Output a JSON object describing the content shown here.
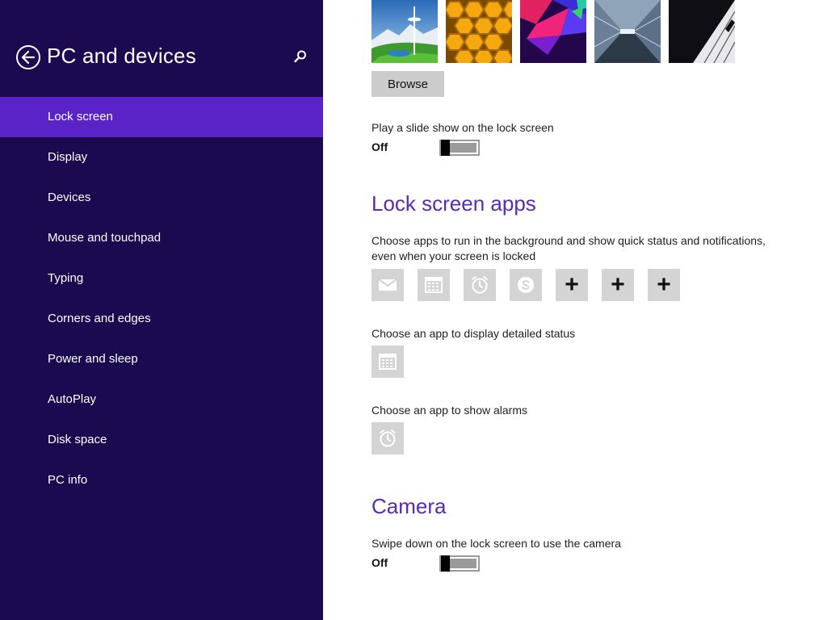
{
  "sidebar": {
    "title": "PC and devices",
    "items": [
      {
        "label": "Lock screen",
        "active": true
      },
      {
        "label": "Display"
      },
      {
        "label": "Devices"
      },
      {
        "label": "Mouse and touchpad"
      },
      {
        "label": "Typing"
      },
      {
        "label": "Corners and edges"
      },
      {
        "label": "Power and sleep"
      },
      {
        "label": "AutoPlay"
      },
      {
        "label": "Disk space"
      },
      {
        "label": "PC info"
      }
    ]
  },
  "main": {
    "browse_label": "Browse",
    "slideshow": {
      "label": "Play a slide show on the lock screen",
      "state": "Off"
    },
    "lock_apps": {
      "heading": "Lock screen apps",
      "desc": "Choose apps to run in the background and show quick status and notifications, even when your screen is locked",
      "apps": [
        "mail-icon",
        "calendar-icon",
        "alarm-icon",
        "skype-icon",
        "plus-icon",
        "plus-icon",
        "plus-icon"
      ],
      "plus_symbol": "+"
    },
    "detailed_status": {
      "label": "Choose an app to display detailed status",
      "app": "calendar-icon"
    },
    "alarms": {
      "label": "Choose an app to show alarms",
      "app": "alarm-icon"
    },
    "camera": {
      "heading": "Camera",
      "label": "Swipe down on the lock screen to use the camera",
      "state": "Off"
    }
  },
  "colors": {
    "sidebar_bg": "#1b0a4f",
    "sidebar_active": "#5a23c8",
    "heading": "#5a2ab0",
    "tile_bg": "#d4d4d4"
  }
}
